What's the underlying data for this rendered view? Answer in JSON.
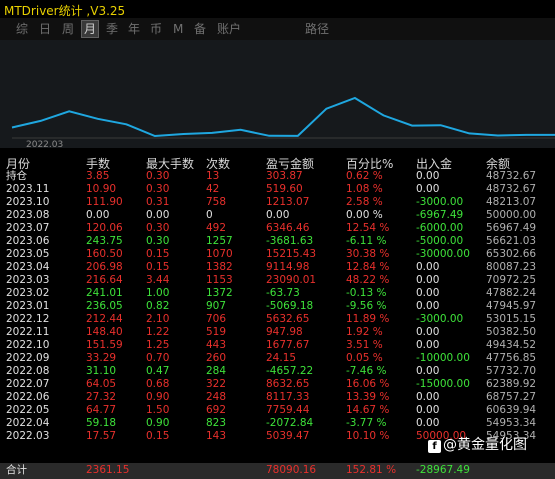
{
  "app_title": "MTDriver统计 ,V3.25",
  "tabs": [
    "综",
    "日",
    "周",
    "月",
    "季",
    "年",
    "币",
    "M",
    "备",
    "账户",
    "路径"
  ],
  "active_tab": "月",
  "chart": {
    "date_label": "2022.03",
    "line_color": "#1fa7e0",
    "balance_series": [
      48732.67,
      48732.67,
      48213.07,
      50000.0,
      56967.49,
      56621.03,
      65302.66,
      80087.23,
      70972.25,
      47882.24,
      47945.97,
      53015.15,
      50382.5,
      49434.52,
      47756.85,
      57732.7,
      62389.92,
      68757.27,
      60639.94,
      54953.34
    ]
  },
  "headers": [
    "月份",
    "手数",
    "最大手数",
    "次数",
    "盈亏金额",
    "百分比%",
    "出入金",
    "余额"
  ],
  "rows": [
    [
      "持仓",
      "3.85",
      "0.30",
      "13",
      "303.87",
      "0.62 %",
      "0.00",
      "48732.67"
    ],
    [
      "2023.11",
      "10.90",
      "0.30",
      "42",
      "519.60",
      "1.08 %",
      "0.00",
      "48732.67"
    ],
    [
      "2023.10",
      "111.90",
      "0.31",
      "758",
      "1213.07",
      "2.58 %",
      "-3000.00",
      "48213.07"
    ],
    [
      "2023.08",
      "0.00",
      "0.00",
      "0",
      "0.00",
      "0.00 %",
      "-6967.49",
      "50000.00"
    ],
    [
      "2023.07",
      "120.06",
      "0.30",
      "492",
      "6346.46",
      "12.54 %",
      "-6000.00",
      "56967.49"
    ],
    [
      "2023.06",
      "243.75",
      "0.30",
      "1257",
      "-3681.63",
      "-6.11 %",
      "-5000.00",
      "56621.03"
    ],
    [
      "2023.05",
      "160.50",
      "0.15",
      "1070",
      "15215.43",
      "30.38 %",
      "-30000.00",
      "65302.66"
    ],
    [
      "2023.04",
      "206.98",
      "0.15",
      "1382",
      "9114.98",
      "12.84 %",
      "0.00",
      "80087.23"
    ],
    [
      "2023.03",
      "216.64",
      "3.44",
      "1153",
      "23090.01",
      "48.22 %",
      "0.00",
      "70972.25"
    ],
    [
      "2023.02",
      "241.01",
      "1.00",
      "1372",
      "-63.73",
      "-0.13 %",
      "0.00",
      "47882.24"
    ],
    [
      "2023.01",
      "236.05",
      "0.82",
      "907",
      "-5069.18",
      "-9.56 %",
      "0.00",
      "47945.97"
    ],
    [
      "2022.12",
      "212.44",
      "2.10",
      "706",
      "5632.65",
      "11.89 %",
      "-3000.00",
      "53015.15"
    ],
    [
      "2022.11",
      "148.40",
      "1.22",
      "519",
      "947.98",
      "1.92 %",
      "0.00",
      "50382.50"
    ],
    [
      "2022.10",
      "151.59",
      "1.25",
      "443",
      "1677.67",
      "3.51 %",
      "0.00",
      "49434.52"
    ],
    [
      "2022.09",
      "33.29",
      "0.70",
      "260",
      "24.15",
      "0.05 %",
      "-10000.00",
      "47756.85"
    ],
    [
      "2022.08",
      "31.10",
      "0.47",
      "284",
      "-4657.22",
      "-7.46 %",
      "0.00",
      "57732.70"
    ],
    [
      "2022.07",
      "64.05",
      "0.68",
      "322",
      "8632.65",
      "16.06 %",
      "-15000.00",
      "62389.92"
    ],
    [
      "2022.06",
      "27.32",
      "0.90",
      "248",
      "8117.33",
      "13.39 %",
      "0.00",
      "68757.27"
    ],
    [
      "2022.05",
      "64.77",
      "1.50",
      "692",
      "7759.44",
      "14.67 %",
      "0.00",
      "60639.94"
    ],
    [
      "2022.04",
      "59.18",
      "0.90",
      "823",
      "-2072.84",
      "-3.77 %",
      "0.00",
      "54953.34"
    ],
    [
      "2022.03",
      "17.57",
      "0.15",
      "143",
      "5039.47",
      "10.10 %",
      "50000.00",
      "54953.34"
    ]
  ],
  "total": [
    "合计",
    "2361.15",
    "",
    "",
    "78090.16",
    "152.81 %",
    "-28967.49",
    ""
  ],
  "watermark": "@黄金量化图",
  "watermark_icon": "f",
  "colors": {
    "profit": "#e8302c",
    "loss": "#3ee23a",
    "neutral": "#e0e0e0",
    "title": "#e8d000"
  }
}
